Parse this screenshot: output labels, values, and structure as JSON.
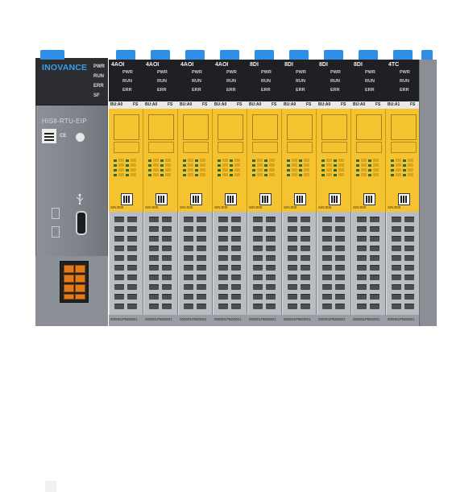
{
  "head_module": {
    "brand": "INOVANCE",
    "model": "HIS8-RTU-EIP",
    "leds": [
      "PWR",
      "RUN",
      "ERR",
      "SF"
    ],
    "ce_mark": "CE"
  },
  "io_modules": [
    {
      "type": "4AOI",
      "leds": [
        "PWR",
        "RUN",
        "ERR"
      ],
      "bu": "BU:A0",
      "fs": "FS",
      "sn": "S/N:000",
      "serial": "000001PB00001"
    },
    {
      "type": "4AOI",
      "leds": [
        "PWR",
        "RUN",
        "ERR"
      ],
      "bu": "BU:A0",
      "fs": "FS",
      "sn": "S/N:000",
      "serial": "000001PB00001"
    },
    {
      "type": "4AOI",
      "leds": [
        "PWR",
        "RUN",
        "ERR"
      ],
      "bu": "BU:A0",
      "fs": "FS",
      "sn": "S/N:000",
      "serial": "000001PB00001"
    },
    {
      "type": "4AOI",
      "leds": [
        "PWR",
        "RUN",
        "ERR"
      ],
      "bu": "BU:A0",
      "fs": "FS",
      "sn": "S/N:000",
      "serial": "000001PB00001"
    },
    {
      "type": "8DI",
      "leds": [
        "PWR",
        "RUN",
        "ERR"
      ],
      "bu": "BU:A0",
      "fs": "FS",
      "sn": "S/N:000",
      "serial": "000001PB00001"
    },
    {
      "type": "8DI",
      "leds": [
        "PWR",
        "RUN",
        "ERR"
      ],
      "bu": "BU:A0",
      "fs": "FS",
      "sn": "S/N:000",
      "serial": "000001PB00001"
    },
    {
      "type": "8DI",
      "leds": [
        "PWR",
        "RUN",
        "ERR"
      ],
      "bu": "BU:A0",
      "fs": "FS",
      "sn": "S/N:000",
      "serial": "000001PB00001"
    },
    {
      "type": "8DI",
      "leds": [
        "PWR",
        "RUN",
        "ERR"
      ],
      "bu": "BU:A0",
      "fs": "FS",
      "sn": "S/N:000",
      "serial": "000001PB00001"
    },
    {
      "type": "4TC",
      "leds": [
        "PWR",
        "RUN",
        "ERR"
      ],
      "bu": "BU:A1",
      "fs": "FS",
      "sn": "S/N:000",
      "serial": "000001PB00001"
    }
  ],
  "colors": {
    "brand_blue": "#2f8ee6",
    "module_yellow": "#f5c32f",
    "housing_gray": "#b9bcc1",
    "top_black": "#1f2023",
    "terminal_orange": "#e47b17"
  }
}
